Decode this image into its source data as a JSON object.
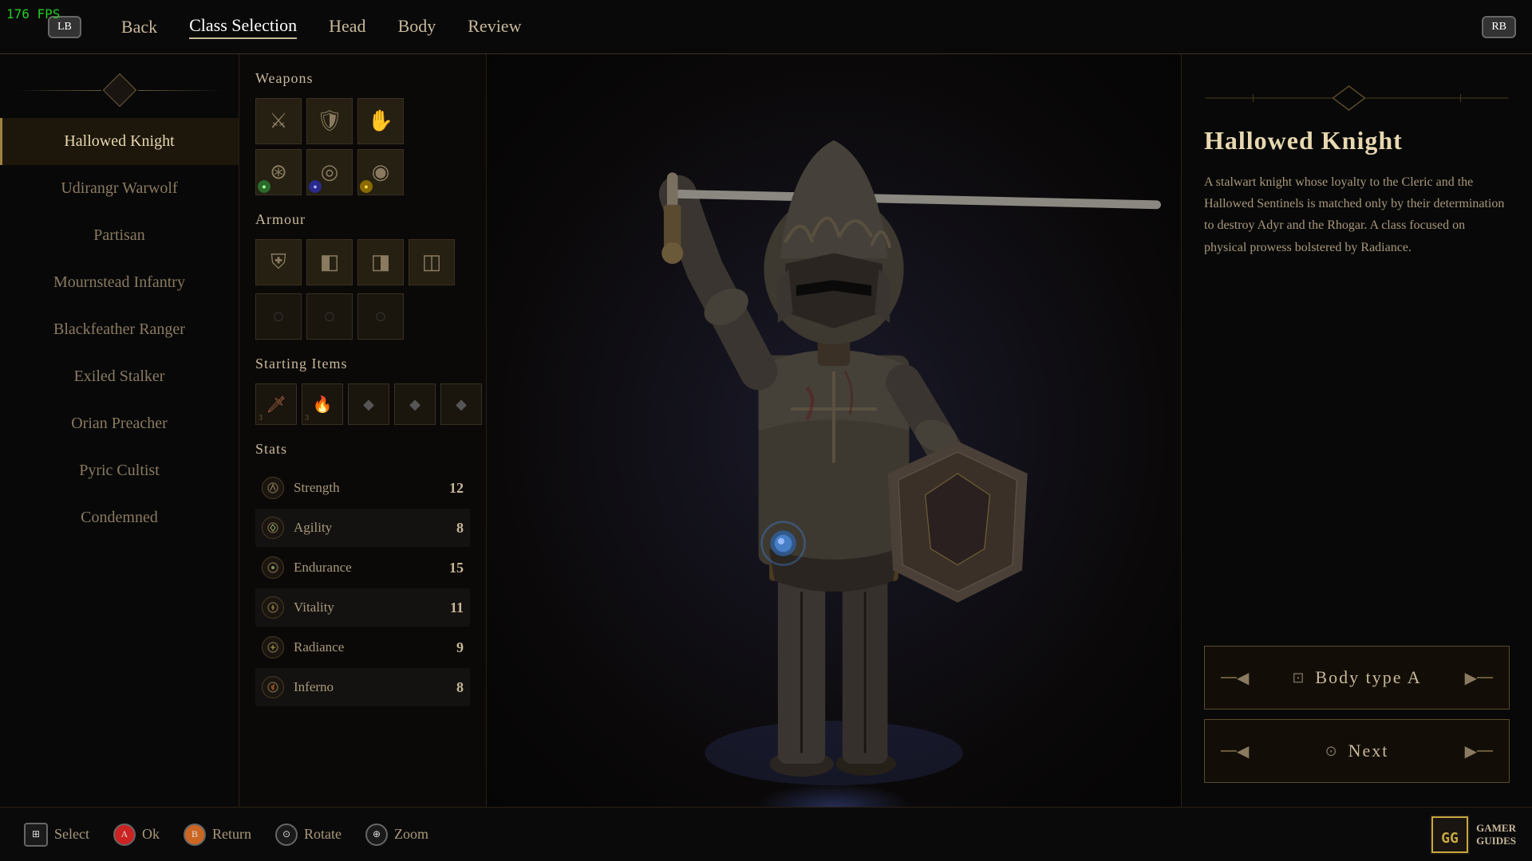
{
  "fps": "176 FPS",
  "nav": {
    "lb_label": "LB",
    "rb_label": "RB",
    "back_label": "Back",
    "class_selection_label": "Class Selection",
    "head_label": "Head",
    "body_label": "Body",
    "review_label": "Review"
  },
  "classes": [
    {
      "id": "hallowed-knight",
      "name": "Hallowed Knight",
      "active": true
    },
    {
      "id": "udirangr-warwolf",
      "name": "Udirangr Warwolf",
      "active": false
    },
    {
      "id": "partisan",
      "name": "Partisan",
      "active": false
    },
    {
      "id": "mournstead-infantry",
      "name": "Mournstead Infantry",
      "active": false
    },
    {
      "id": "blackfeather-ranger",
      "name": "Blackfeather Ranger",
      "active": false
    },
    {
      "id": "exiled-stalker",
      "name": "Exiled Stalker",
      "active": false
    },
    {
      "id": "orian-preacher",
      "name": "Orian Preacher",
      "active": false
    },
    {
      "id": "pyric-cultist",
      "name": "Pyric Cultist",
      "active": false
    },
    {
      "id": "condemned",
      "name": "Condemned",
      "active": false
    }
  ],
  "weapons_label": "Weapons",
  "armour_label": "Armour",
  "starting_items_label": "Starting Items",
  "stats_label": "Stats",
  "stats": [
    {
      "name": "Strength",
      "value": 12,
      "icon": "S"
    },
    {
      "name": "Agility",
      "value": 8,
      "icon": "A"
    },
    {
      "name": "Endurance",
      "value": 15,
      "icon": "E"
    },
    {
      "name": "Vitality",
      "value": 11,
      "icon": "V"
    },
    {
      "name": "Radiance",
      "value": 9,
      "icon": "R"
    },
    {
      "name": "Inferno",
      "value": 8,
      "icon": "I"
    }
  ],
  "selected_class": {
    "title": "Hallowed Knight",
    "description": "A stalwart knight whose loyalty to the Cleric and the Hallowed Sentinels is matched only by their determination to destroy Adyr and the Rhogar. A class focused on physical prowess bolstered by Radiance."
  },
  "body_type": {
    "label": "Body type A"
  },
  "next_label": "Next",
  "bottom_bar": {
    "select_label": "Select",
    "ok_label": "Ok",
    "return_label": "Return",
    "rotate_label": "Rotate",
    "zoom_label": "Zoom",
    "select_btn": "⊞",
    "ok_btn": "A",
    "return_btn": "B",
    "rotate_btn": "⊙",
    "zoom_btn": "⊕"
  },
  "gamer_guides": "GAMER\nGUIDES"
}
